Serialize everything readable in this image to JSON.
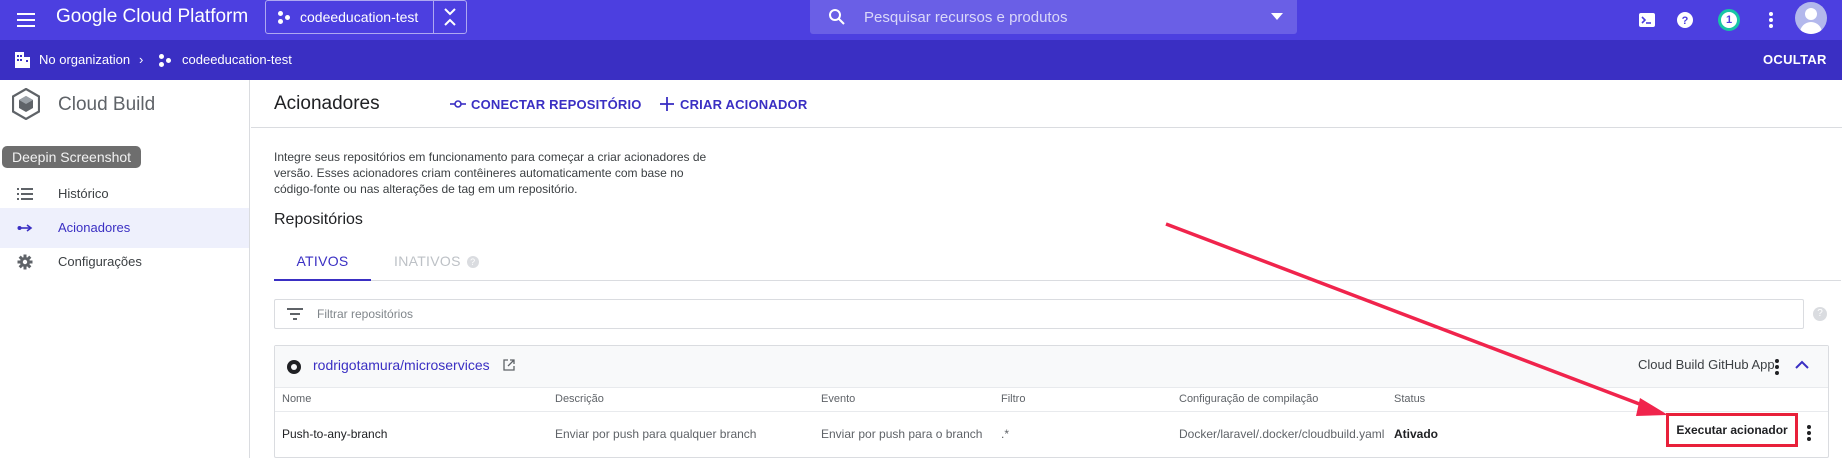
{
  "topbar": {
    "brand": "Google Cloud Platform",
    "project": "codeeducation-test",
    "search_placeholder": "Pesquisar recursos e produtos",
    "notification_count": "1",
    "accent_color": "#4c3fe0"
  },
  "breadcrumb": {
    "organization": "No organization",
    "project": "codeeducation-test",
    "hide_label": "OCULTAR"
  },
  "sidebar": {
    "title": "Cloud Build",
    "tooltip": "Deepin Screenshot",
    "items": [
      {
        "label": "Histórico",
        "icon": "list-icon",
        "active": false
      },
      {
        "label": "Acionadores",
        "icon": "arrows-icon",
        "active": true
      },
      {
        "label": "Configurações",
        "icon": "gear-icon",
        "active": false
      }
    ]
  },
  "main": {
    "title": "Acionadores",
    "connect_label": "CONECTAR REPOSITÓRIO",
    "create_label": "CRIAR ACIONADOR",
    "intro_lines": [
      "Integre seus repositórios em funcionamento para começar a criar acionadores de",
      "versão. Esses acionadores criam contêineres automaticamente com base no",
      "código-fonte ou nas alterações de tag em um repositório."
    ],
    "section_title": "Repositórios",
    "tabs": [
      {
        "label": "ATIVOS",
        "active": true
      },
      {
        "label": "INATIVOS",
        "active": false
      }
    ],
    "filter_placeholder": "Filtrar repositórios",
    "repo": {
      "name": "rodrigotamura/microservices",
      "app": "Cloud Build GitHub App",
      "columns": [
        "Nome",
        "Descrição",
        "Evento",
        "Filtro",
        "Configuração de compilação",
        "Status"
      ],
      "row": {
        "name": "Push-to-any-branch",
        "description": "Enviar por push para qualquer branch",
        "event": "Enviar por push para o branch",
        "filter": ".*",
        "config": "Docker/laravel/.docker/cloudbuild.yaml",
        "status": "Ativado",
        "run_label": "Executar acionador"
      }
    }
  }
}
